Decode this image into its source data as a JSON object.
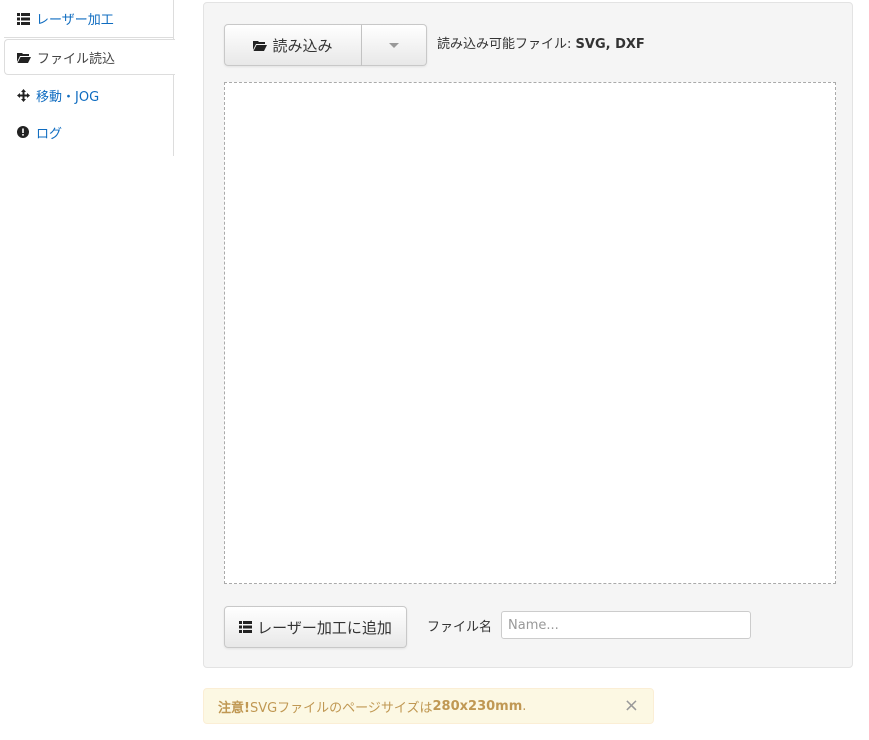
{
  "nav": {
    "items": [
      {
        "label": "レーザー加工",
        "icon": "list-icon"
      },
      {
        "label": "ファイル読込",
        "icon": "folder-open-icon"
      },
      {
        "label": "移動・JOG",
        "icon": "move-arrows-icon"
      },
      {
        "label": "ログ",
        "icon": "exclamation-circle-icon"
      }
    ]
  },
  "toolbar": {
    "load_label": "読み込み",
    "filetypes_prefix": "読み込み可能ファイル: ",
    "filetypes_value": "SVG, DXF"
  },
  "footer": {
    "add_label": "レーザー加工に追加",
    "filename_label": "ファイル名",
    "filename_placeholder": "Name...",
    "filename_value": ""
  },
  "alert": {
    "strong": "注意!",
    "text": " SVGファイルのページサイズは ",
    "size": "280x230mm",
    "end": ".",
    "close": "×"
  },
  "colors": {
    "link": "#0f6cc0",
    "alert_bg": "#fcf8e3",
    "alert_text": "#c09853"
  }
}
